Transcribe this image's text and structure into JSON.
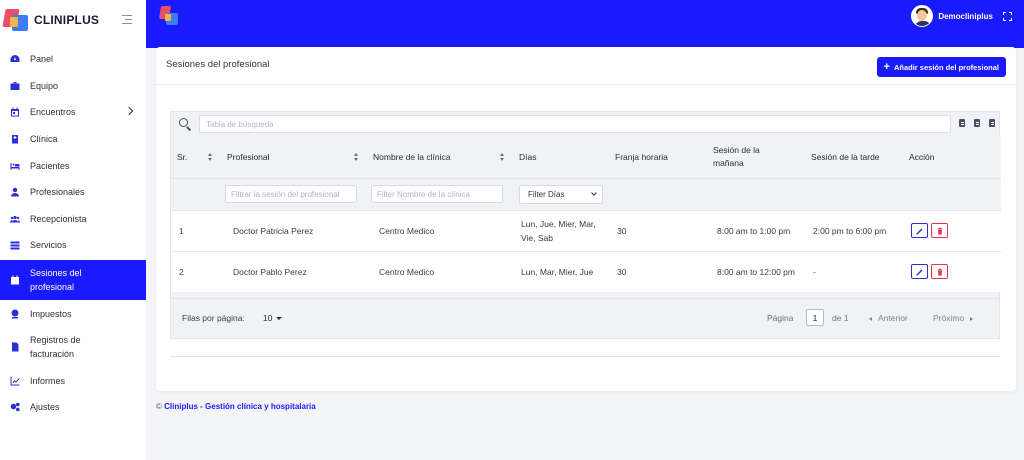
{
  "brand": {
    "name": "CLINIPLUS"
  },
  "sidebar": {
    "items": [
      {
        "label": "Panel",
        "icon": "dashboard-icon"
      },
      {
        "label": "Equipo",
        "icon": "briefcase-icon"
      },
      {
        "label": "Encuentros",
        "icon": "calendar-icon"
      },
      {
        "label": "Clínica",
        "icon": "hospital-icon"
      },
      {
        "label": "Pacientes",
        "icon": "patient-bed-icon"
      },
      {
        "label": "Profesionales",
        "icon": "doctor-icon"
      },
      {
        "label": "Recepcionista",
        "icon": "users-icon"
      },
      {
        "label": "Servicios",
        "icon": "server-icon"
      },
      {
        "label": "Sesiones del profesional",
        "icon": "calendar-session-icon"
      },
      {
        "label": "Impuestos",
        "icon": "tax-icon"
      },
      {
        "label": "Registros de facturación",
        "icon": "invoice-icon"
      },
      {
        "label": "Informes",
        "icon": "chart-line-icon"
      },
      {
        "label": "Ajustes",
        "icon": "gears-icon"
      }
    ]
  },
  "topbar": {
    "username": "Democliniplus"
  },
  "page": {
    "title": "Sesiones del profesional",
    "add_button": "Añadir sesión del profesional",
    "search_placeholder": "Tabla de búsqueda"
  },
  "table": {
    "columns": [
      "Sr.",
      "Profesional",
      "Nombre de la clínica",
      "Días",
      "Franja horaria",
      "Sesión de la mañana",
      "Sesión de la tarde",
      "Acción"
    ],
    "filters": {
      "professional_placeholder": "Filtrar la sesión del profesional",
      "clinic_placeholder": "Filter Nombre de la clínica",
      "days_select": "Filter Días"
    },
    "rows": [
      {
        "sr": "1",
        "professional": "Doctor Patricia Perez",
        "clinic": "Centro Medico",
        "days": "Lun, Jue, Mier, Mar, Vie, Sab",
        "slot": "30",
        "morning": "8:00 am to 1:00 pm",
        "evening": "2:00 pm to 6:00 pm"
      },
      {
        "sr": "2",
        "professional": "Doctor Pablo Perez",
        "clinic": "Centro Medico",
        "days": "Lun, Mar, Mier, Jue",
        "slot": "30",
        "morning": "8:00 am to 12:00 pm",
        "evening": "-"
      }
    ]
  },
  "pagination": {
    "rows_per_page_label": "Filas por página:",
    "rows_per_page": "10",
    "page_label": "Página",
    "current_page": "1",
    "of_label": "de 1",
    "prev": "Anterior",
    "next": "Próximo"
  },
  "footer": {
    "copyright": "©",
    "link": "Cliniplus - Gestión clínica y hospitalaria"
  },
  "colors": {
    "accent": "#1a1aff",
    "danger": "#e53446"
  }
}
